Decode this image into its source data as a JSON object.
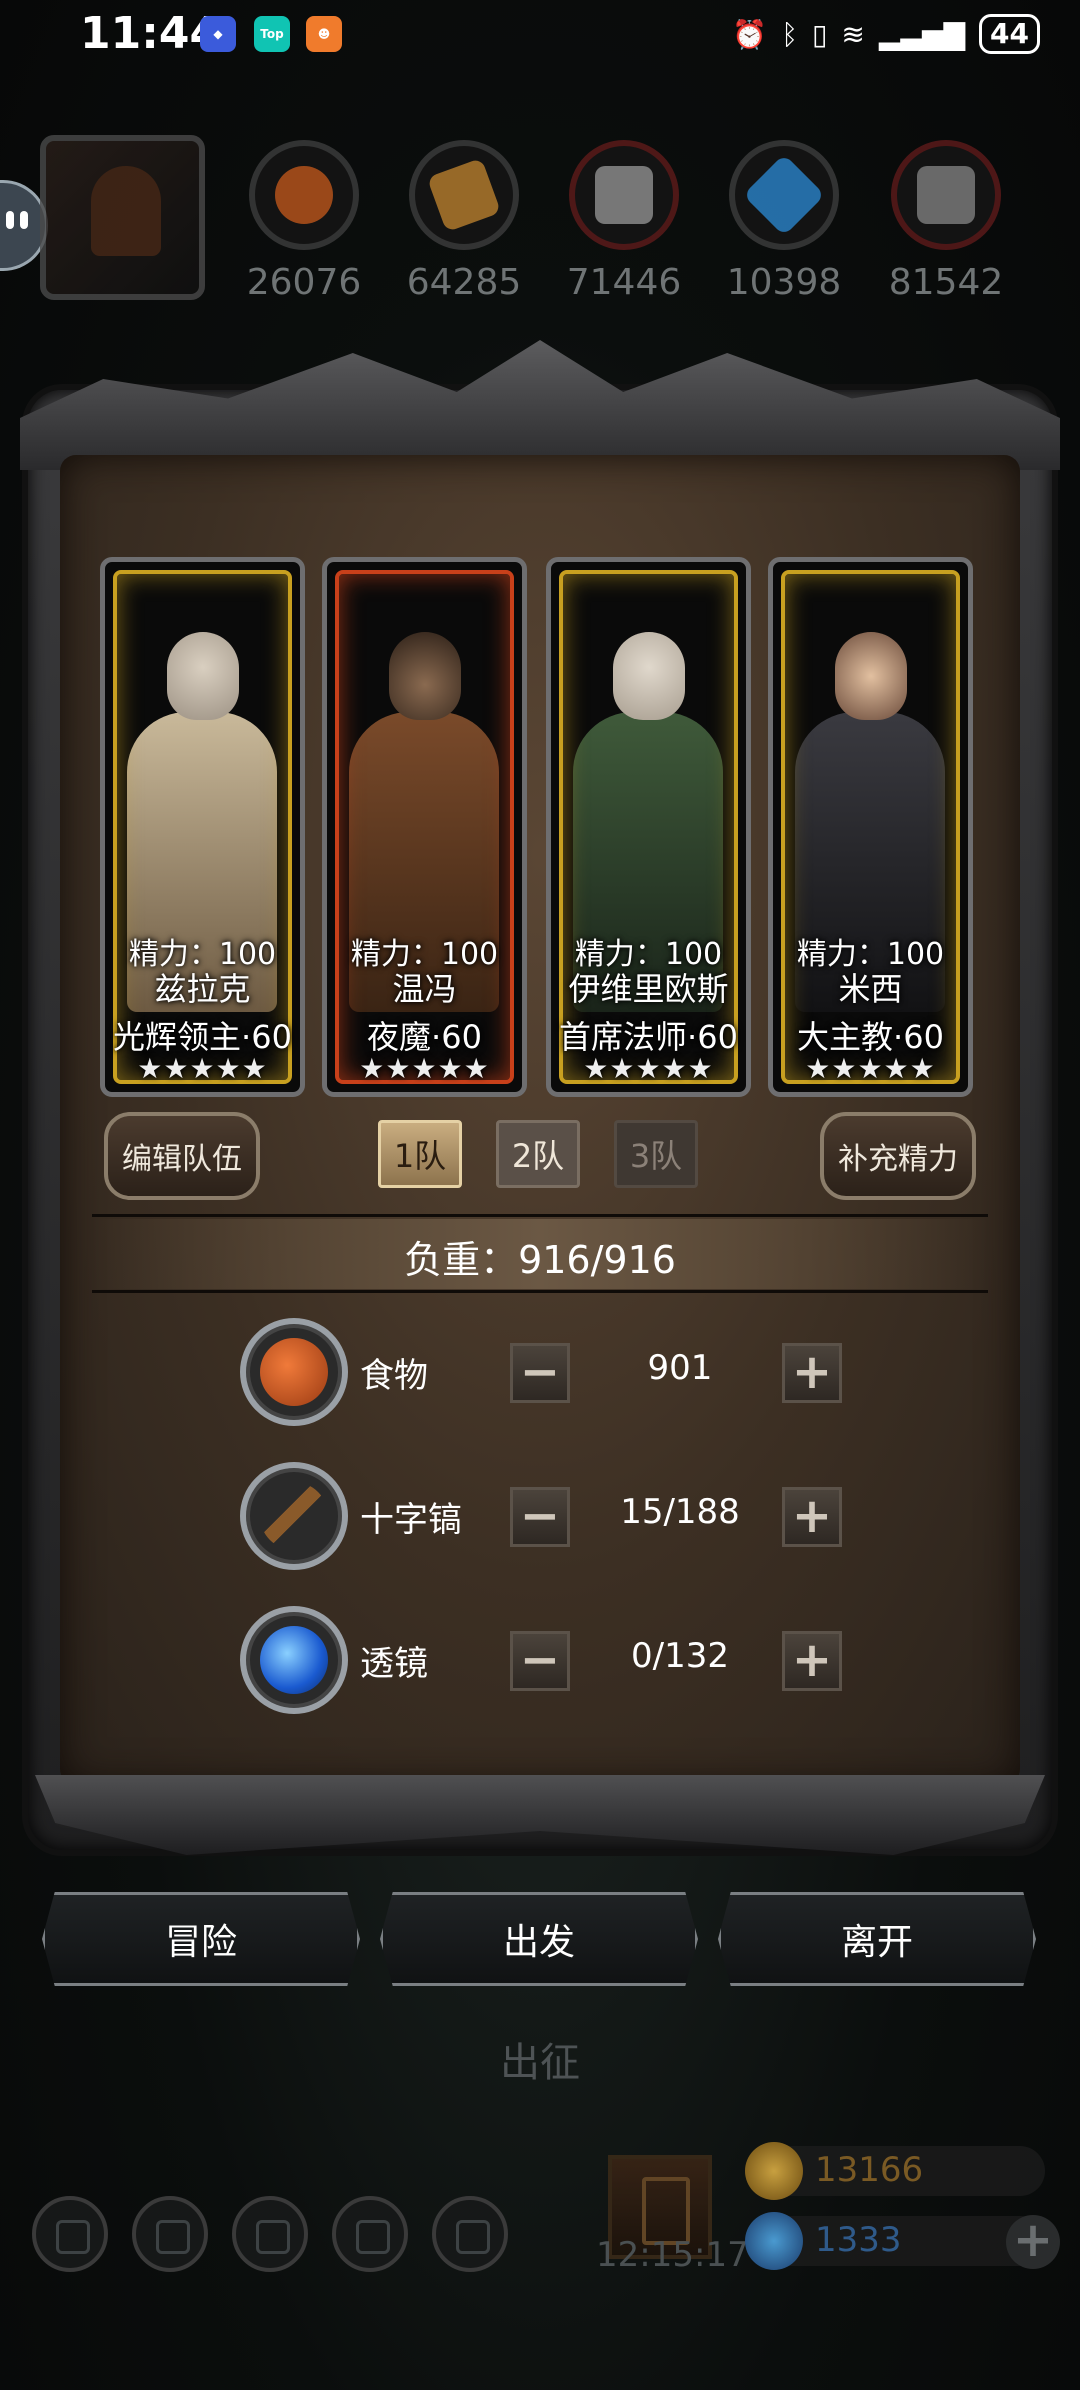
{
  "status_bar": {
    "time": "11:44",
    "battery": "44",
    "apps": [
      "Top"
    ]
  },
  "resources": [
    {
      "icon": "meat-icon",
      "value": "26076",
      "color": "#b4531c"
    },
    {
      "icon": "wood-icon",
      "value": "64285",
      "color": "#b07a2e"
    },
    {
      "icon": "stone-icon",
      "value": "71446",
      "color": "#8a8a8a"
    },
    {
      "icon": "crystal-icon",
      "value": "10398",
      "color": "#2a7fc2"
    },
    {
      "icon": "iron-icon",
      "value": "81542",
      "color": "#7a7a7a"
    }
  ],
  "heroes": [
    {
      "energy": "精力：100",
      "name": "兹拉克",
      "title": "光辉领主·60",
      "stars": "★★★★★",
      "border": "gold"
    },
    {
      "energy": "精力：100",
      "name": "温冯",
      "title": "夜魔·60",
      "stars": "★★★★★",
      "border": "red"
    },
    {
      "energy": "精力：100",
      "name": "伊维里欧斯",
      "title": "首席法师·60",
      "stars": "★★★★★",
      "border": "gold"
    },
    {
      "energy": "精力：100",
      "name": "米西",
      "title": "大主教·60",
      "stars": "★★★★★",
      "border": "gold"
    }
  ],
  "controls": {
    "edit_team": "编辑队伍",
    "refill_energy": "补充精力",
    "teams": [
      "1队",
      "2队",
      "3队"
    ]
  },
  "capacity": "负重：916/916",
  "supplies": [
    {
      "icon": "food-icon",
      "label": "食物",
      "value": "901"
    },
    {
      "icon": "pickaxe-icon",
      "label": "十字镐",
      "value": "15/188"
    },
    {
      "icon": "lens-icon",
      "label": "透镜",
      "value": "0/132"
    }
  ],
  "stepper": {
    "minus": "−",
    "plus": "+"
  },
  "actions": {
    "adventure": "冒险",
    "depart": "出发",
    "leave": "离开"
  },
  "expedition_label": "出征",
  "bottom": {
    "timer": "12:15:17",
    "gold": "13166",
    "gems": "1333",
    "plus": "+"
  }
}
